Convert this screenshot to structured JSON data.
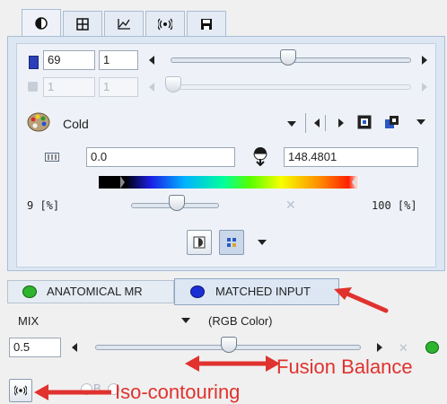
{
  "tabs": [
    {
      "icon": "contrast-icon"
    },
    {
      "icon": "grid-icon"
    },
    {
      "icon": "chart-icon"
    },
    {
      "icon": "iso-contour-icon"
    },
    {
      "icon": "save-icon"
    }
  ],
  "frame": {
    "value": "69",
    "step": "1"
  },
  "frame_disabled": {
    "value": "1",
    "step": "1"
  },
  "colormap": {
    "name": "Cold"
  },
  "range": {
    "min": "0.0",
    "max": "148.4801"
  },
  "percent": {
    "low": "9 [%]",
    "high": "100 [%]"
  },
  "sources": {
    "anatomical": "ANATOMICAL MR",
    "matched": "MATCHED INPUT"
  },
  "fusion": {
    "mode": "MIX",
    "color_mode": "(RGB Color)",
    "value": "0.5"
  },
  "annotations": {
    "fusion_balance": "Fusion Balance",
    "iso_contouring": "Iso-contouring",
    "bi_label": "B"
  },
  "colors": {
    "accent_red": "#e0322e",
    "green_dot": "#2db52d",
    "blue_dot": "#1a2fd6"
  }
}
